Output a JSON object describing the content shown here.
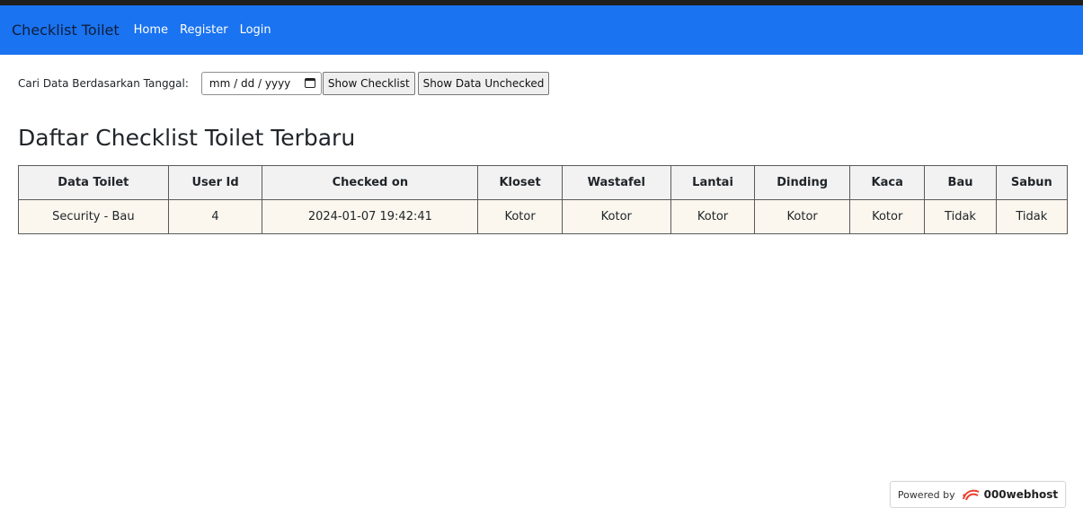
{
  "navbar": {
    "brand": "Checklist Toilet",
    "links": [
      "Home",
      "Register",
      "Login"
    ],
    "background_color": "#1a73f0"
  },
  "search": {
    "label": "Cari Data Berdasarkan Tanggal:",
    "date_placeholder": "mm / dd / yyyy",
    "show_checklist_label": "Show Checklist",
    "show_unchecked_label": "Show Data Unchecked"
  },
  "main": {
    "title": "Daftar Checklist Toilet Terbaru"
  },
  "table": {
    "headers": [
      "Data Toilet",
      "User Id",
      "Checked on",
      "Kloset",
      "Wastafel",
      "Lantai",
      "Dinding",
      "Kaca",
      "Bau",
      "Sabun"
    ],
    "rows": [
      [
        "Security - Bau",
        "4",
        "2024-01-07 19:42:41",
        "Kotor",
        "Kotor",
        "Kotor",
        "Kotor",
        "Kotor",
        "Tidak",
        "Tidak"
      ]
    ]
  },
  "footer": {
    "powered_by": "Powered by",
    "host_brand": "000webhost"
  }
}
